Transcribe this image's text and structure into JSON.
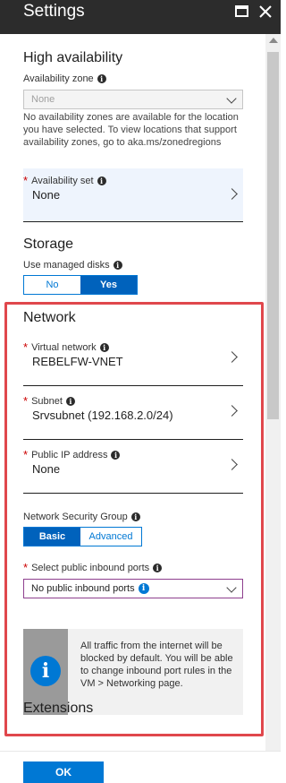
{
  "window": {
    "title": "Settings"
  },
  "high_availability": {
    "heading": "High availability",
    "zone_label": "Availability zone",
    "zone_value": "None",
    "zone_note": "No availability zones are available for the location you have selected. To view locations that support availability zones, go to aka.ms/zonedregions",
    "set_label": "Availability set",
    "set_value": "None"
  },
  "storage": {
    "heading": "Storage",
    "managed_label": "Use managed disks",
    "options": [
      "No",
      "Yes"
    ],
    "selected": "Yes"
  },
  "network": {
    "heading": "Network",
    "vnet_label": "Virtual network",
    "vnet_value": "REBELFW-VNET",
    "subnet_label": "Subnet",
    "subnet_value": "Srvsubnet (192.168.2.0/24)",
    "pip_label": "Public IP address",
    "pip_value": "None",
    "nsg_label": "Network Security Group",
    "nsg_options": [
      "Basic",
      "Advanced"
    ],
    "nsg_selected": "Basic",
    "inbound_label": "Select public inbound ports",
    "inbound_value": "No public inbound ports",
    "info_text": "All traffic from the internet will be blocked by default. You will be able to change inbound port rules in the VM > Networking page."
  },
  "extensions": {
    "heading": "Extensions"
  },
  "footer": {
    "ok_label": "OK"
  },
  "colors": {
    "accent": "#0078d4",
    "highlight": "#e0474c",
    "title_bar": "#2c2c2c"
  }
}
